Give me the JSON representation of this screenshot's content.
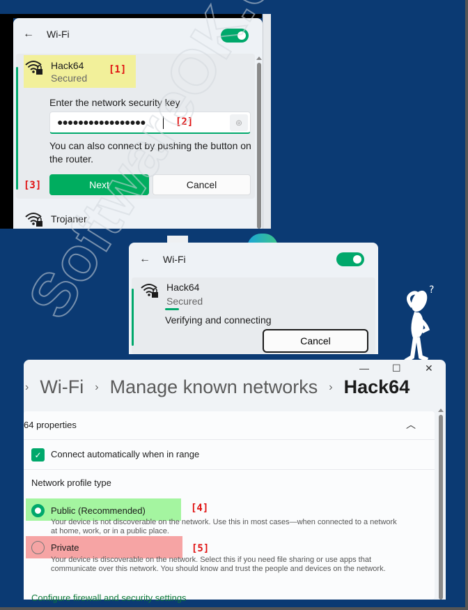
{
  "panel1": {
    "back_icon": "arrow-left-icon",
    "title": "Wi-Fi",
    "toggle_on": true,
    "network": {
      "name": "Hack64",
      "status": "Secured",
      "icon": "wifi-secured-icon"
    },
    "annotation_1": "[1]",
    "key_label": "Enter the network security key",
    "password_dots": "●●●●●●●●●●●●●●●●●",
    "annotation_2": "[2]",
    "reveal_icon": "eye-icon",
    "help_text": "You can also connect by pushing the button on the router.",
    "annotation_3": "[3]",
    "next_label": "Next",
    "cancel_label": "Cancel",
    "other_network": "Trojaner"
  },
  "panel2": {
    "title": "Wi-Fi",
    "toggle_on": true,
    "network": {
      "name": "Hack64",
      "status": "Secured"
    },
    "progress_text": "Verifying and connecting",
    "cancel_label": "Cancel"
  },
  "settings": {
    "window_controls": {
      "minimize": "—",
      "maximize": "☐",
      "close": "✕"
    },
    "breadcrumb": [
      "Wi-Fi",
      "Manage known networks",
      "Hack64"
    ],
    "breadcrumb_sep": "›",
    "properties_title": "64 properties",
    "connect_auto_label": "Connect automatically when in range",
    "connect_auto_checked": true,
    "profile_type_label": "Network profile type",
    "profiles": [
      {
        "label": "Public (Recommended)",
        "selected": true,
        "annotation": "[4]",
        "description": "Your device is not discoverable on the network. Use this in most cases—when connected to a network at home, work, or in a public place."
      },
      {
        "label": "Private",
        "selected": false,
        "annotation": "[5]",
        "description": "Your device is discoverable on the network. Select this if you need file sharing or use apps that communicate over this network. You should know and trust the people and devices on the network."
      }
    ],
    "firewall_link": "Configure firewall and security settings"
  },
  "watermark": "SoftwareOK.com",
  "colors": {
    "accent_green": "#00a86b",
    "background_blue": "#0b3a73",
    "annotation_red": "#e01010",
    "highlight_yellow": "#f2f09a",
    "highlight_green": "#a4f5a0",
    "highlight_red": "#f6a4a4"
  }
}
